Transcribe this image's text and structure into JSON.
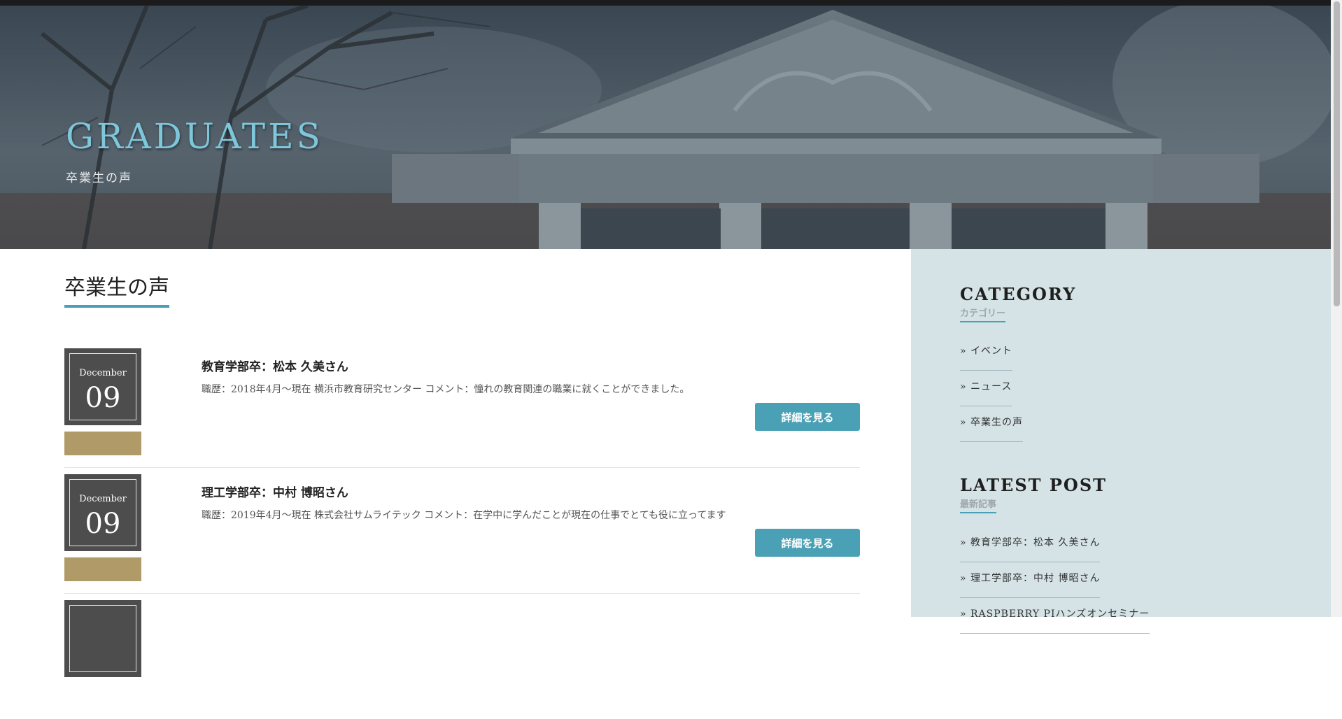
{
  "hero": {
    "title": "GRADUATES",
    "subtitle": "卒業生の声"
  },
  "main": {
    "section_title": "卒業生の声",
    "posts": [
      {
        "month": "December",
        "day": "09",
        "title": "教育学部卒：松本 久美さん",
        "text": "職歴：2018年4月～現在 横浜市教育研究センター コメント：憧れの教育関連の職業に就くことができました。",
        "button": "詳細を見る"
      },
      {
        "month": "December",
        "day": "09",
        "title": "理工学部卒：中村 博昭さん",
        "text": "職歴：2019年4月～現在 株式会社サムライテック コメント：在学中に学んだことが現在の仕事でとても役に立ってます",
        "button": "詳細を見る"
      },
      {
        "month": "",
        "day": "",
        "title": "",
        "text": "",
        "button": ""
      }
    ]
  },
  "sidebar": {
    "category": {
      "title": "CATEGORY",
      "subtitle": "カテゴリー",
      "items": [
        "» イベント",
        "» ニュース",
        "» 卒業生の声"
      ]
    },
    "latest": {
      "title": "LATEST POST",
      "subtitle": "最新記事",
      "items": [
        "» 教育学部卒：松本 久美さん",
        "» 理工学部卒：中村 博昭さん",
        "» RASPBERRY PIハンズオンセミナー"
      ]
    }
  },
  "colors": {
    "accent": "#4aa1b5",
    "gold": "#b09a68",
    "date_box": "#4d4d4d",
    "sidebar_bg": "#d5e3e6",
    "hero_title": "#7ec6da"
  }
}
